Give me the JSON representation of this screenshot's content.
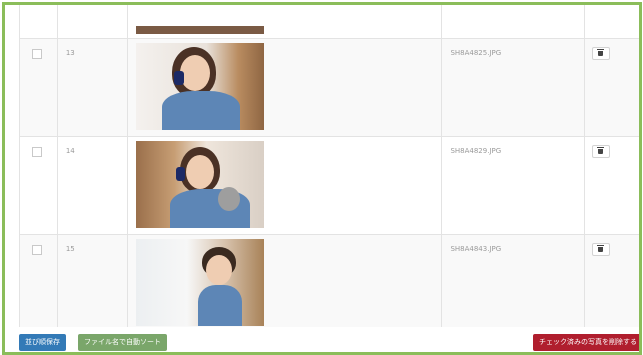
{
  "rows": [
    {
      "number": "13",
      "filename": "SH8A4825.JPG"
    },
    {
      "number": "14",
      "filename": "SH8A4829.JPG"
    },
    {
      "number": "15",
      "filename": "SH8A4843.JPG"
    }
  ],
  "actions": {
    "save_order": "並び順保存",
    "auto_sort": "ファイル名で自動ソート",
    "delete_checked": "チェック済みの写真を削除する"
  },
  "colors": {
    "frame_border": "#8bbd5a",
    "save_button": "#337ab7",
    "sort_button": "#7aa66a",
    "delete_button": "#b01e2e"
  },
  "icons": {
    "delete_row": "trash-icon"
  }
}
